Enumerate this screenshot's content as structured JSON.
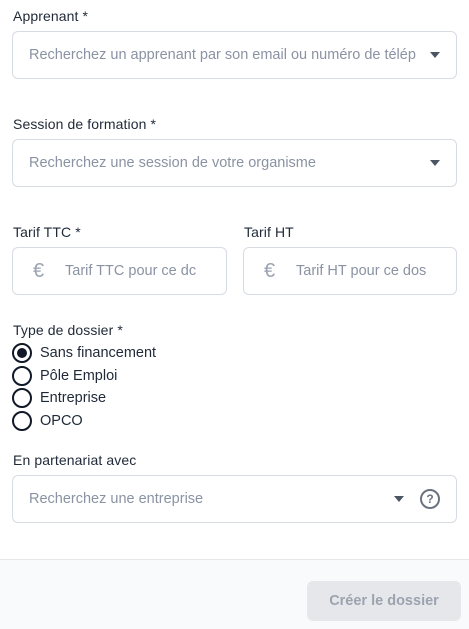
{
  "learner": {
    "label": "Apprenant *",
    "placeholder": "Recherchez un apprenant par son email ou numéro de télép"
  },
  "session": {
    "label": "Session de formation *",
    "placeholder": "Recherchez une session de votre organisme"
  },
  "price_ttc": {
    "label": "Tarif TTC *",
    "currency_symbol": "€",
    "placeholder": "Tarif TTC pour ce dc"
  },
  "price_ht": {
    "label": "Tarif HT",
    "currency_symbol": "€",
    "placeholder": "Tarif HT pour ce dos"
  },
  "folder_type": {
    "label": "Type de dossier *",
    "options": [
      {
        "label": "Sans financement",
        "checked": true
      },
      {
        "label": "Pôle Emploi",
        "checked": false
      },
      {
        "label": "Entreprise",
        "checked": false
      },
      {
        "label": "OPCO",
        "checked": false
      }
    ]
  },
  "partnership": {
    "label": "En partenariat avec",
    "placeholder": "Recherchez une entreprise",
    "help_symbol": "?"
  },
  "footer": {
    "submit_label": "Créer le dossier"
  }
}
